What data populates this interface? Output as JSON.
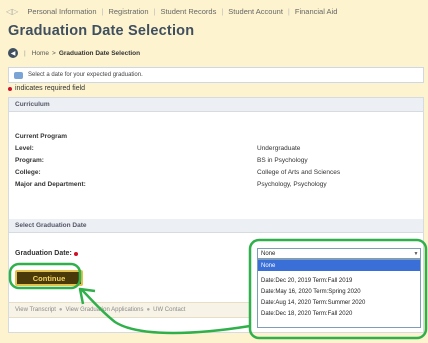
{
  "topnav": {
    "items": [
      "Personal Information",
      "Registration",
      "Student Records",
      "Student Account",
      "Financial Aid"
    ]
  },
  "page": {
    "title": "Graduation Date Selection"
  },
  "breadcrumb": {
    "home": "Home",
    "separator": ">",
    "current": "Graduation Date Selection"
  },
  "info": {
    "text": "Select a date for your expected graduation."
  },
  "required_note": "indicates required field",
  "curriculum": {
    "header": "Curriculum",
    "current_program_label": "Current Program",
    "rows": [
      {
        "label": "Level:",
        "value": "Undergraduate"
      },
      {
        "label": "Program:",
        "value": "BS in Psychology"
      },
      {
        "label": "College:",
        "value": "College of Arts and Sciences"
      },
      {
        "label": "Major and Department:",
        "value": "Psychology, Psychology"
      }
    ]
  },
  "grad_select": {
    "header": "Select Graduation Date",
    "label": "Graduation Date:",
    "selected": "None",
    "options": [
      "None",
      "Date:Dec 20, 2019 Term:Fall 2019",
      "Date:May 16, 2020 Term:Spring 2020",
      "Date:Aug 14, 2020 Term:Summer 2020",
      "Date:Dec 18, 2020 Term:Fall 2020"
    ]
  },
  "continue_label": "Continue",
  "footer": {
    "links": [
      "View Transcript",
      "View Graduation Applications",
      "UW Contact"
    ]
  },
  "colors": {
    "page_bg": "#fdf3cf",
    "title": "#3f4f5f",
    "required": "#d0102a",
    "dropdown_highlight": "#3a6fd8",
    "annotation": "#2fb04a",
    "button_bg": "#4a3a0a",
    "button_text": "#f4d35e"
  }
}
